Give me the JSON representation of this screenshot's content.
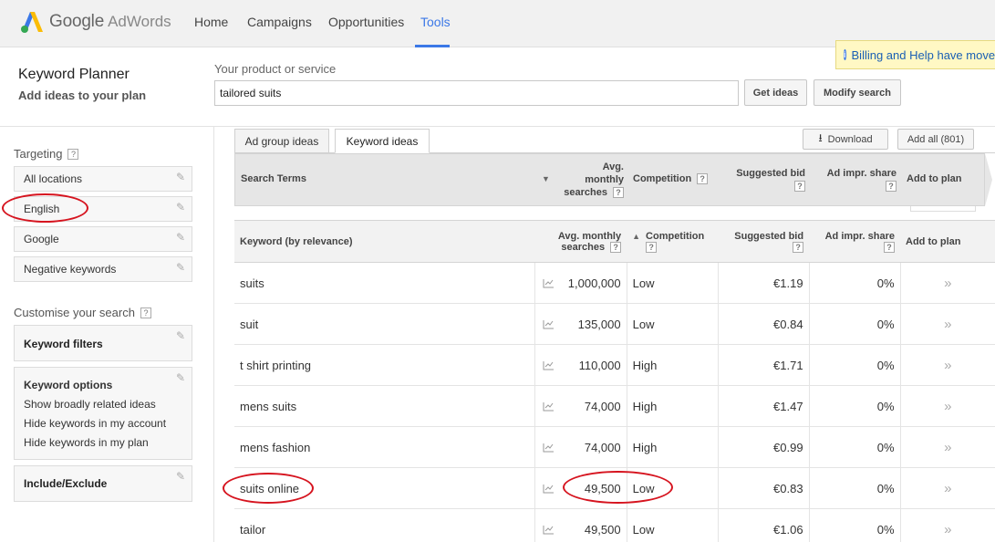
{
  "app": {
    "logo_google": "Google",
    "logo_adwords": "AdWords"
  },
  "nav": {
    "items": [
      "Home",
      "Campaigns",
      "Opportunities",
      "Tools"
    ],
    "active": "Tools"
  },
  "notice": {
    "text": "Billing and Help have moved"
  },
  "header": {
    "title": "Keyword Planner",
    "subtitle": "Add ideas to your plan",
    "product_label": "Your product or service",
    "product_value": "tailored suits",
    "get_ideas": "Get ideas",
    "modify_search": "Modify search"
  },
  "sidebar": {
    "targeting_label": "Targeting",
    "targeting": [
      "All locations",
      "English",
      "Google",
      "Negative keywords"
    ],
    "customise_label": "Customise your search",
    "keyword_filters": "Keyword filters",
    "keyword_options": {
      "title": "Keyword options",
      "options": [
        "Show broadly related ideas",
        "Hide keywords in my account",
        "Hide keywords in my plan"
      ]
    },
    "include_exclude": "Include/Exclude"
  },
  "tabs": {
    "ad_group": "Ad group ideas",
    "keyword": "Keyword ideas",
    "active": "Keyword ideas"
  },
  "actions": {
    "download": "Download",
    "add_all": "Add all (801)"
  },
  "search_terms_table": {
    "headers": {
      "search_terms": "Search Terms",
      "avg_l1": "Avg.",
      "avg_l2": "monthly",
      "avg_l3": "searches",
      "competition": "Competition",
      "bid": "Suggested bid",
      "share": "Ad impr. share",
      "add": "Add to plan"
    }
  },
  "keyword_table": {
    "headers": {
      "keyword": "Keyword (by relevance)",
      "avg_l1": "Avg. monthly",
      "avg_l2": "searches",
      "competition": "Competition",
      "bid": "Suggested bid",
      "share": "Ad impr. share",
      "add": "Add to plan"
    },
    "rows": [
      {
        "keyword": "suits",
        "searches": "1,000,000",
        "competition": "Low",
        "bid": "€1.19",
        "share": "0%"
      },
      {
        "keyword": "suit",
        "searches": "135,000",
        "competition": "Low",
        "bid": "€0.84",
        "share": "0%"
      },
      {
        "keyword": "t shirt printing",
        "searches": "110,000",
        "competition": "High",
        "bid": "€1.71",
        "share": "0%"
      },
      {
        "keyword": "mens suits",
        "searches": "74,000",
        "competition": "High",
        "bid": "€1.47",
        "share": "0%"
      },
      {
        "keyword": "mens fashion",
        "searches": "74,000",
        "competition": "High",
        "bid": "€0.99",
        "share": "0%"
      },
      {
        "keyword": "suits online",
        "searches": "49,500",
        "competition": "Low",
        "bid": "€0.83",
        "share": "0%"
      },
      {
        "keyword": "tailor",
        "searches": "49,500",
        "competition": "Low",
        "bid": "€1.06",
        "share": "0%"
      }
    ]
  },
  "colors": {
    "accent": "#3b78e7",
    "annotation": "#d6141f",
    "notice_bg": "#fff8c4"
  }
}
